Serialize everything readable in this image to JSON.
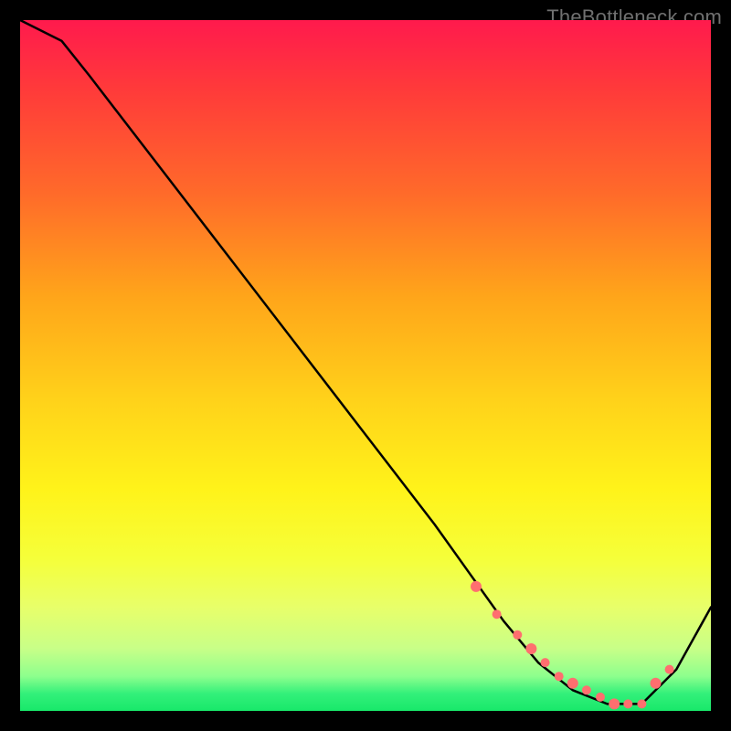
{
  "watermark": "TheBottleneck.com",
  "colors": {
    "background": "#000000",
    "curve_stroke": "#000000",
    "dot_fill": "#ff6f6f",
    "gradient_top": "#ff1a4d",
    "gradient_mid": "#fff31a",
    "gradient_bottom": "#18e86a"
  },
  "chart_data": {
    "type": "line",
    "title": "",
    "xlabel": "",
    "ylabel": "",
    "xlim": [
      0,
      100
    ],
    "ylim": [
      0,
      100
    ],
    "grid": false,
    "legend": false,
    "annotations": [
      "TheBottleneck.com"
    ],
    "series": [
      {
        "name": "bottleneck-curve",
        "x": [
          0,
          6,
          10,
          20,
          30,
          40,
          50,
          60,
          65,
          70,
          75,
          80,
          85,
          90,
          95,
          100
        ],
        "values": [
          100,
          97,
          92,
          79,
          66,
          53,
          40,
          27,
          20,
          13,
          7,
          3,
          1,
          1,
          6,
          15
        ]
      }
    ],
    "optimal_dots": {
      "x": [
        66,
        69,
        72,
        74,
        76,
        78,
        80,
        82,
        84,
        86,
        88,
        90,
        92,
        94
      ],
      "values": [
        18,
        14,
        11,
        9,
        7,
        5,
        4,
        3,
        2,
        1,
        1,
        1,
        4,
        6
      ]
    }
  }
}
